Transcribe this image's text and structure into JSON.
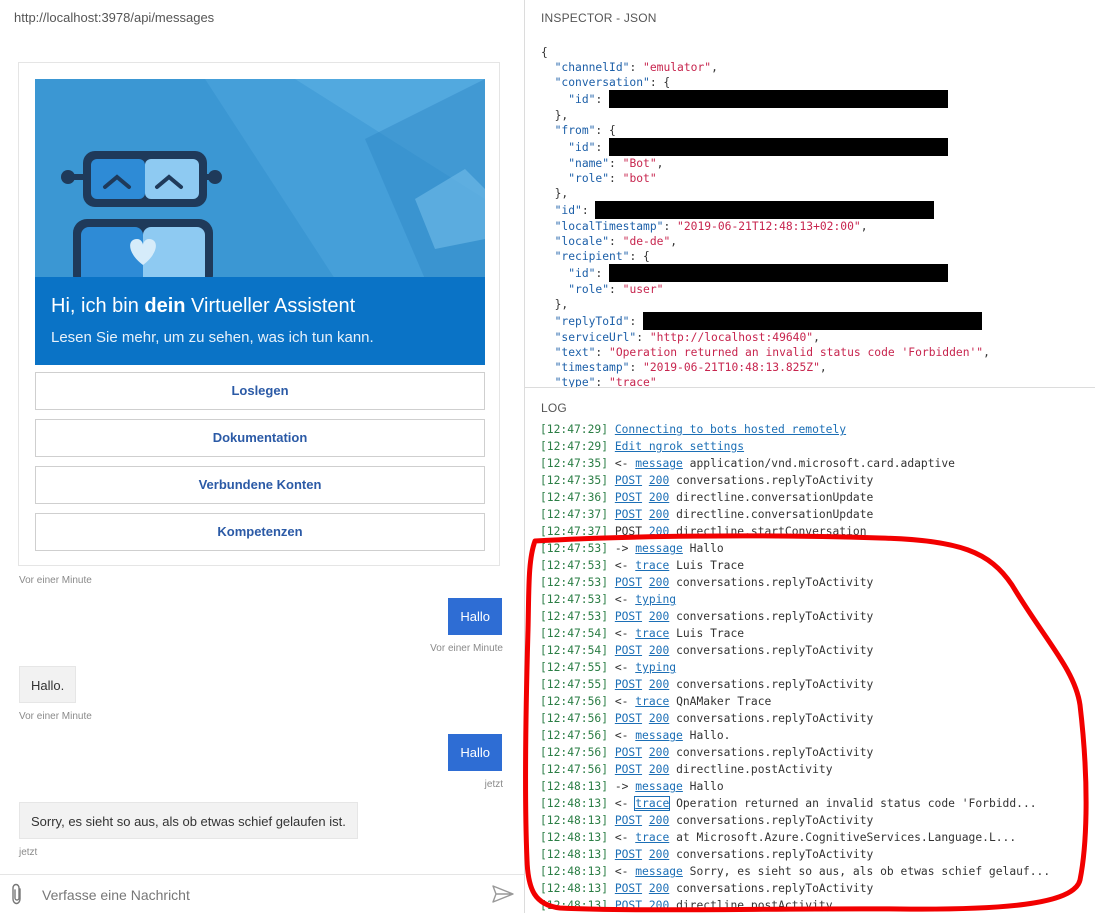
{
  "chat": {
    "url": "http://localhost:3978/api/messages",
    "card": {
      "title_pre": "Hi, ich bin ",
      "title_bold": "dein",
      "title_post": " Virtueller Assistent",
      "subtitle": "Lesen Sie mehr, um zu sehen, was ich tun kann.",
      "buttons": [
        "Loslegen",
        "Dokumentation",
        "Verbundene Konten",
        "Kompetenzen"
      ],
      "timestamp": "Vor einer Minute"
    },
    "messages": [
      {
        "from": "user",
        "text": "Hallo",
        "timestamp": "Vor einer Minute"
      },
      {
        "from": "bot",
        "text": "Hallo.",
        "timestamp": "Vor einer Minute"
      },
      {
        "from": "user",
        "text": "Hallo",
        "timestamp": "jetzt"
      },
      {
        "from": "bot",
        "text": "Sorry, es sieht so aus, als ob etwas schief gelaufen ist.",
        "timestamp": "jetzt"
      }
    ],
    "composer": {
      "placeholder": "Verfasse eine Nachricht"
    },
    "colors": {
      "user_bubble": "#2e6dd4",
      "hero_band": "#0a73c6",
      "button_text": "#2b5aa6"
    }
  },
  "inspector": {
    "title": "INSPECTOR - JSON",
    "json": {
      "open": "{",
      "channelId_key": "\"channelId\"",
      "channelId_val": "\"emulator\"",
      "conversation_key": "\"conversation\"",
      "id_key": "\"id\"",
      "from_key": "\"from\"",
      "name_key": "\"name\"",
      "name_val": "\"Bot\"",
      "role_key": "\"role\"",
      "role_bot": "\"bot\"",
      "localTimestamp_key": "\"localTimestamp\"",
      "localTimestamp_val": "\"2019-06-21T12:48:13+02:00\"",
      "locale_key": "\"locale\"",
      "locale_val": "\"de-de\"",
      "recipient_key": "\"recipient\"",
      "role_user": "\"user\"",
      "replyToId_key": "\"replyToId\"",
      "serviceUrl_key": "\"serviceUrl\"",
      "serviceUrl_val": "\"http://localhost:49640\"",
      "text_key": "\"text\"",
      "text_val": "\"Operation returned an invalid status code 'Forbidden'\"",
      "timestamp_key": "\"timestamp\"",
      "timestamp_val": "\"2019-06-21T10:48:13.825Z\"",
      "type_key": "\"type\"",
      "type_val": "\"trace\""
    }
  },
  "log": {
    "title": "LOG",
    "lines": [
      {
        "ts": "[12:47:29]",
        "link": "Connecting to bots hosted remotely",
        "text": ""
      },
      {
        "ts": "[12:47:29]",
        "link": "Edit ngrok settings",
        "text": ""
      },
      {
        "ts": "[12:47:35]",
        "arrow": "<-",
        "link": "message",
        "text": "application/vnd.microsoft.card.adaptive"
      },
      {
        "ts": "[12:47:35]",
        "link": "POST",
        "link2": "200",
        "text": "conversations.replyToActivity"
      },
      {
        "ts": "[12:47:36]",
        "link": "POST",
        "link2": "200",
        "text": "directline.conversationUpdate"
      },
      {
        "ts": "[12:47:37]",
        "link": "POST",
        "link2": "200",
        "text": "directline.conversationUpdate"
      },
      {
        "ts": "[12:47:37]",
        "plain": "POST",
        "link2": "200",
        "text": "directline.startConversation"
      },
      {
        "ts": "[12:47:53]",
        "arrow": "->",
        "link": "message",
        "text": "Hallo"
      },
      {
        "ts": "[12:47:53]",
        "arrow": "<-",
        "link": "trace",
        "text": "Luis Trace"
      },
      {
        "ts": "[12:47:53]",
        "link": "POST",
        "link2": "200",
        "text": "conversations.replyToActivity"
      },
      {
        "ts": "[12:47:53]",
        "arrow": "<-",
        "link": "typing",
        "text": ""
      },
      {
        "ts": "[12:47:53]",
        "link": "POST",
        "link2": "200",
        "text": "conversations.replyToActivity"
      },
      {
        "ts": "[12:47:54]",
        "arrow": "<-",
        "link": "trace",
        "text": "Luis Trace"
      },
      {
        "ts": "[12:47:54]",
        "link": "POST",
        "link2": "200",
        "text": "conversations.replyToActivity"
      },
      {
        "ts": "[12:47:55]",
        "arrow": "<-",
        "link": "typing",
        "text": ""
      },
      {
        "ts": "[12:47:55]",
        "link": "POST",
        "link2": "200",
        "text": "conversations.replyToActivity"
      },
      {
        "ts": "[12:47:56]",
        "arrow": "<-",
        "link": "trace",
        "text": "QnAMaker Trace"
      },
      {
        "ts": "[12:47:56]",
        "link": "POST",
        "link2": "200",
        "text": "conversations.replyToActivity"
      },
      {
        "ts": "[12:47:56]",
        "arrow": "<-",
        "link": "message",
        "text": "Hallo."
      },
      {
        "ts": "[12:47:56]",
        "link": "POST",
        "link2": "200",
        "text": "conversations.replyToActivity"
      },
      {
        "ts": "[12:47:56]",
        "link": "POST",
        "link2": "200",
        "text": "directline.postActivity"
      },
      {
        "ts": "[12:48:13]",
        "arrow": "->",
        "link": "message",
        "text": "Hallo"
      },
      {
        "ts": "[12:48:13]",
        "arrow": "<-",
        "link": "trace",
        "boxed": true,
        "text": "Operation returned an invalid status code 'Forbidd..."
      },
      {
        "ts": "[12:48:13]",
        "link": "POST",
        "link2": "200",
        "text": "conversations.replyToActivity"
      },
      {
        "ts": "[12:48:13]",
        "arrow": "<-",
        "link": "trace",
        "text": " at Microsoft.Azure.CognitiveServices.Language.L..."
      },
      {
        "ts": "[12:48:13]",
        "link": "POST",
        "link2": "200",
        "text": "conversations.replyToActivity"
      },
      {
        "ts": "[12:48:13]",
        "arrow": "<-",
        "link": "message",
        "text": "Sorry, es sieht so aus, als ob etwas schief gelauf..."
      },
      {
        "ts": "[12:48:13]",
        "link": "POST",
        "link2": "200",
        "text": "conversations.replyToActivity"
      },
      {
        "ts": "[12:48:13]",
        "link": "POST",
        "link2": "200",
        "text": "directline.postActivity"
      }
    ]
  }
}
